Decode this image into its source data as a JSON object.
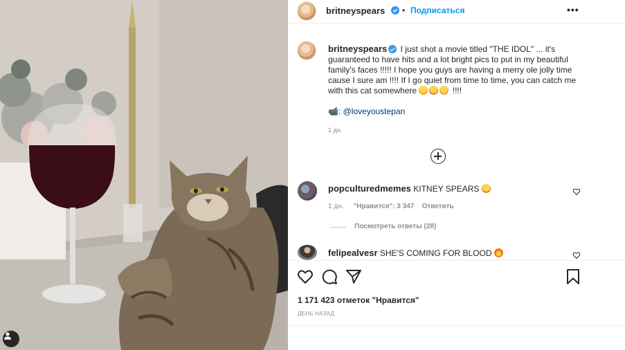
{
  "post": {
    "author": "britneyspears",
    "follow_label": "Подписаться",
    "separator": "•",
    "more_label": "•••",
    "caption": "I just shot a movie titled \"THE IDOL\" ... it's guaranteed to have hits and a lot bright pics to put in my beautiful family's faces !!!!! I hope you guys are having a merry ole jolly time cause I sure am !!!! If I go quiet from time to time, you can catch me with this cat somewhere",
    "caption_end": "!!!!",
    "credit_emoji": "📹:",
    "credit_link": "@loveyoustepan",
    "time_ago": "1 дн."
  },
  "comments": [
    {
      "user": "popculturedmemes",
      "text": "KITNEY SPEARS",
      "time": "1 дн.",
      "likes": "\"Нравится\": 3 347",
      "reply_label": "Ответить",
      "view_replies": "Посмотреть ответы (28)"
    },
    {
      "user": "felipealvesr",
      "text": "SHE'S COMING FOR BLOOD"
    }
  ],
  "stats": {
    "likes": "1 171 423 отметок \"Нравится\"",
    "date": "ДЕНЬ НАЗАД"
  },
  "icons": {
    "like": "heart-icon",
    "comment": "comment-icon",
    "share": "share-icon",
    "save": "bookmark-icon",
    "add": "plus-circle-icon",
    "tag": "user-tag-icon"
  },
  "colors": {
    "link": "#0095f6",
    "verified": "#3897f0",
    "text": "#262626",
    "muted": "#8e8e8e"
  }
}
